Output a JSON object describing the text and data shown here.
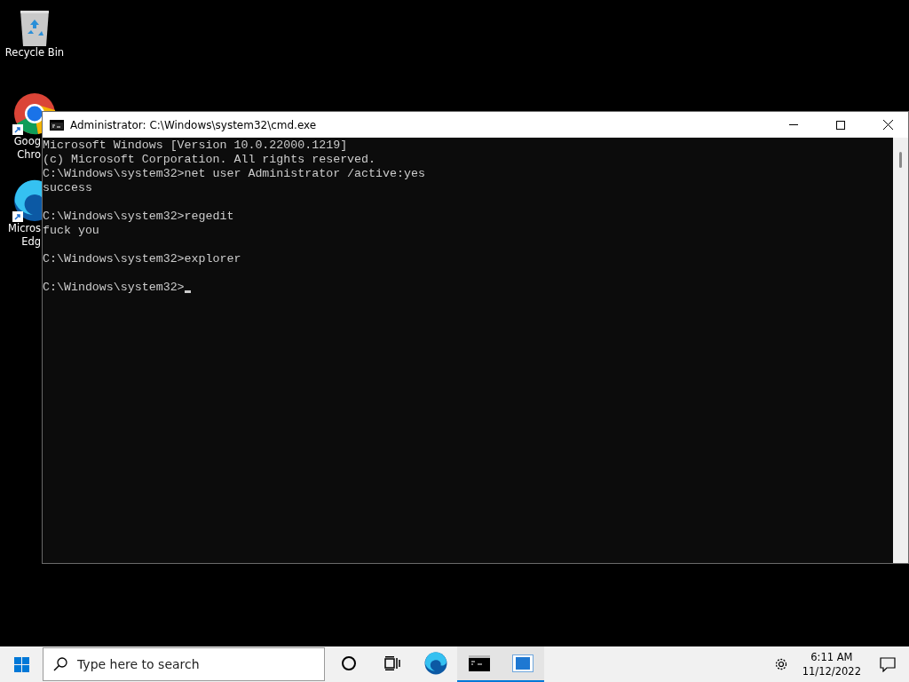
{
  "desktop": {
    "icons": [
      {
        "kind": "recycle",
        "shortcut": false,
        "label_lines": [
          "Recycle Bin"
        ]
      },
      {
        "kind": "chrome",
        "shortcut": true,
        "label_lines": [
          "Goog",
          "Chro"
        ]
      },
      {
        "kind": "edge",
        "shortcut": true,
        "label_lines": [
          "Micros",
          "Edg"
        ]
      }
    ]
  },
  "window": {
    "title": "Administrator: C:\\Windows\\system32\\cmd.exe",
    "cursor": true,
    "console_blocks": [
      [
        "Microsoft Windows [Version 10.0.22000.1219]",
        "(c) Microsoft Corporation. All rights reserved.",
        "C:\\Windows\\system32>net user Administrator /active:yes",
        "success"
      ],
      [
        "C:\\Windows\\system32>regedit",
        "fuck you"
      ],
      [
        "C:\\Windows\\system32>explorer"
      ],
      [
        "C:\\Windows\\system32>"
      ]
    ]
  },
  "taskbar": {
    "search": {
      "placeholder": "Type here to search"
    },
    "apps": [
      {
        "kind": "cortana",
        "running": false
      },
      {
        "kind": "taskview",
        "running": false
      },
      {
        "kind": "edge",
        "running": false
      },
      {
        "kind": "cmd",
        "running": true
      },
      {
        "kind": "window",
        "running": true
      }
    ],
    "time": "6:11 AM",
    "date": "11/12/2022"
  }
}
